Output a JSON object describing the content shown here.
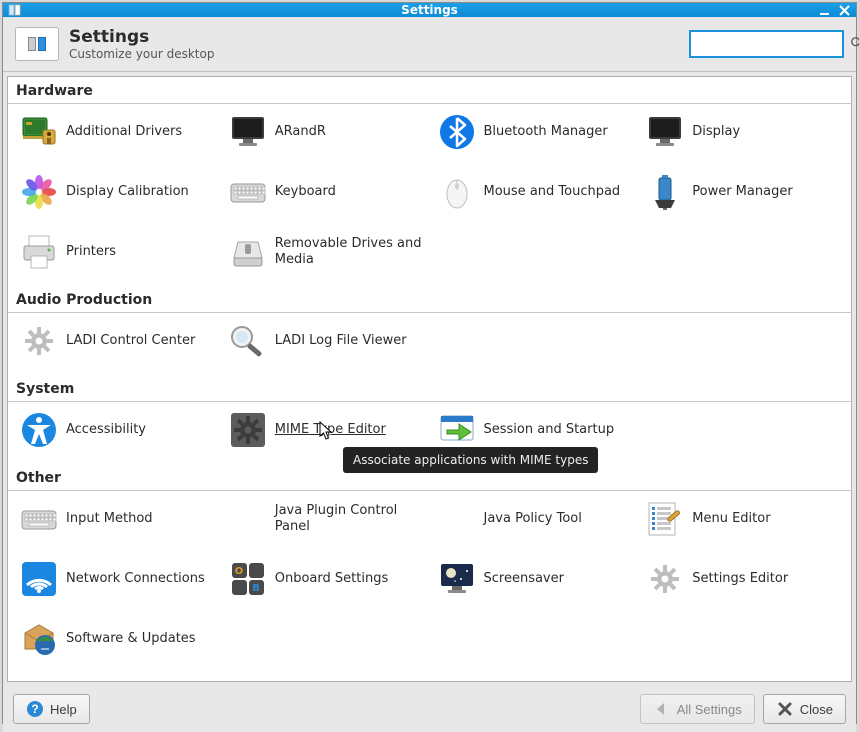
{
  "window": {
    "title": "Settings"
  },
  "header": {
    "title": "Settings",
    "subtitle": "Customize your desktop"
  },
  "search": {
    "value": "",
    "placeholder": ""
  },
  "tooltip": "Associate applications with MIME types",
  "sections": {
    "hardware": {
      "title": "Hardware",
      "items": [
        "Additional Drivers",
        "ARandR",
        "Bluetooth Manager",
        "Display",
        "Display Calibration",
        "Keyboard",
        "Mouse and Touchpad",
        "Power Manager",
        "Printers",
        "Removable Drives and Media"
      ]
    },
    "audio": {
      "title": "Audio Production",
      "items": [
        "LADI Control Center",
        "LADI Log File Viewer"
      ]
    },
    "system": {
      "title": "System",
      "items": [
        "Accessibility",
        "MIME Type Editor",
        "Session and Startup"
      ]
    },
    "other": {
      "title": "Other",
      "items": [
        "Input Method",
        "Java Control Panel",
        "Java Policy Tool",
        "Menu Editor",
        "Network Connections",
        "Onboard Settings",
        "Screensaver",
        "Settings Editor",
        "Software & Updates"
      ]
    }
  },
  "labels_override": {
    "Java Control Panel": "Java Plugin Control Panel"
  },
  "footer": {
    "help": "Help",
    "all_settings": "All Settings",
    "close": "Close"
  }
}
